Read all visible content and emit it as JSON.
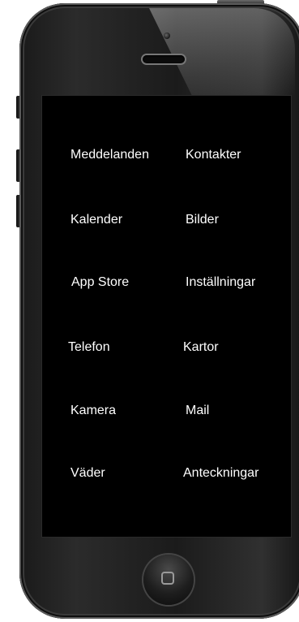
{
  "screen": {
    "apps": [
      {
        "label": "Meddelanden"
      },
      {
        "label": "Kontakter"
      },
      {
        "label": "Kalender"
      },
      {
        "label": "Bilder"
      },
      {
        "label": "App Store"
      },
      {
        "label": "Inställningar"
      },
      {
        "label": "Telefon"
      },
      {
        "label": "Kartor"
      },
      {
        "label": "Kamera"
      },
      {
        "label": "Mail"
      },
      {
        "label": "Väder"
      },
      {
        "label": "Anteckningar"
      }
    ]
  },
  "hardware": {
    "home_button_icon": "home-square-icon",
    "camera_icon": "front-camera-icon",
    "speaker_icon": "speaker-grille-icon"
  },
  "colors": {
    "screen_bg": "#000000",
    "label_text": "#ffffff",
    "frame": "#1e1e1e"
  }
}
